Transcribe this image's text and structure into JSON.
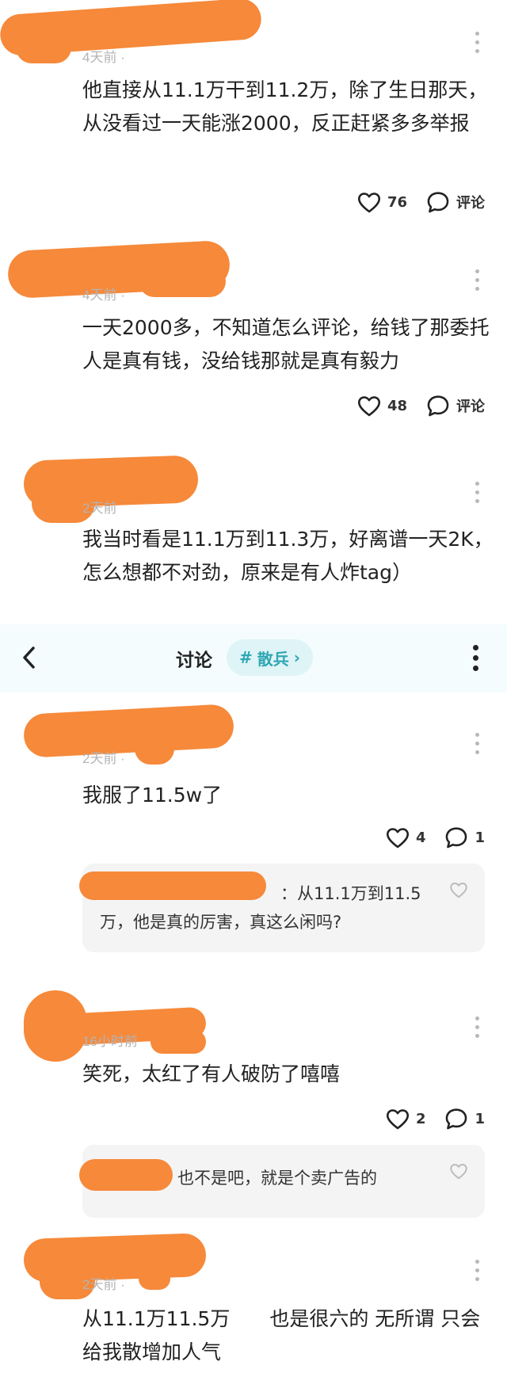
{
  "header": {
    "title": "讨论",
    "topic_hash": "#",
    "topic_label": "散兵",
    "topic_chevron": "›"
  },
  "comments": [
    {
      "time": "4天前 ·",
      "text": "他直接从11.1万干到11.2万，除了生日那天，从没看过一天能涨2000，反正赶紧多多举报",
      "likes": "76",
      "comment_label": "评论"
    },
    {
      "time": "4天前 ·",
      "text": "一天2000多，不知道怎么评论，给钱了那委托人是真有钱，没给钱那就是真有毅力",
      "likes": "48",
      "comment_label": "评论"
    },
    {
      "time": "2天前",
      "text": "我当时看是11.1万到11.3万，好离谱一天2K，怎么想都不对劲，原来是有人炸tag）"
    },
    {
      "time": "2天前 ·",
      "text": "我服了11.5w了",
      "likes": "4",
      "replies": "1",
      "reply_text": "：从11.1万到11.5万，他是真的厉害，真这么闲吗?"
    },
    {
      "time": "16小时前",
      "text": "笑死，太红了有人破防了嘻嘻",
      "likes": "2",
      "replies": "1",
      "reply_text": "也不是吧，就是个卖广告的"
    },
    {
      "time": "2天前 ·",
      "text": "从11.1万11.5万　　也是很六的 无所谓 只会给我散增加人气"
    }
  ],
  "colors": {
    "redaction": "#f6893a",
    "topic_bg": "#dff4f6",
    "topic_fg": "#2fa7b3",
    "bar_bg": "#f4fcfd"
  },
  "icons": [
    "heart-icon",
    "comment-bubble-icon",
    "more-vertical-icon",
    "back-arrow-icon",
    "chevron-right-icon"
  ]
}
